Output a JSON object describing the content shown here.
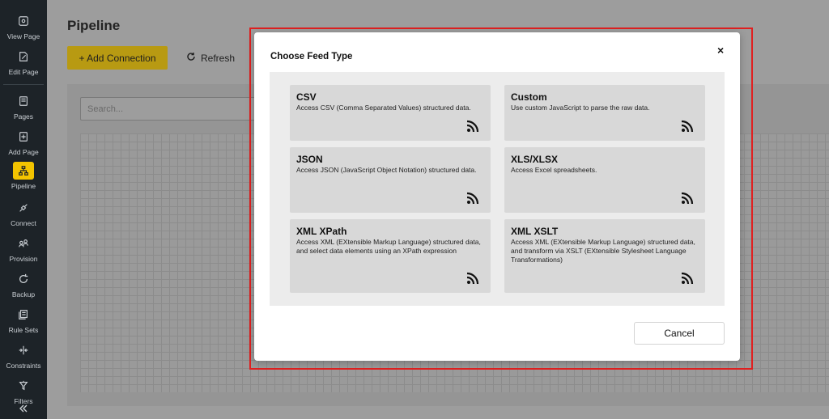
{
  "sidebar": {
    "items": [
      {
        "label": "View Page",
        "icon": "eye-icon"
      },
      {
        "label": "Edit Page",
        "icon": "edit-page-icon"
      },
      {
        "label": "Pages",
        "icon": "pages-icon"
      },
      {
        "label": "Add Page",
        "icon": "add-page-icon"
      },
      {
        "label": "Pipeline",
        "icon": "pipeline-icon",
        "active": true
      },
      {
        "label": "Connect",
        "icon": "connect-icon"
      },
      {
        "label": "Provision",
        "icon": "provision-icon"
      },
      {
        "label": "Backup",
        "icon": "backup-icon"
      },
      {
        "label": "Rule Sets",
        "icon": "rule-sets-icon"
      },
      {
        "label": "Constraints",
        "icon": "constraints-icon"
      },
      {
        "label": "Filters",
        "icon": "filters-icon"
      }
    ],
    "collapse_icon": "double-chevron-left-icon",
    "active_color": "#f3c400"
  },
  "main": {
    "title": "Pipeline",
    "add_connection_label": "+ Add Connection",
    "refresh_label": "Refresh",
    "search_placeholder": "Search..."
  },
  "modal": {
    "title": "Choose Feed Type",
    "close_label": "×",
    "cancel_label": "Cancel",
    "feed_types": [
      {
        "name": "CSV",
        "description": "Access CSV (Comma Separated Values) structured data."
      },
      {
        "name": "Custom",
        "description": "Use custom JavaScript to parse the raw data."
      },
      {
        "name": "JSON",
        "description": "Access JSON (JavaScript Object Notation) structured data."
      },
      {
        "name": "XLS/XLSX",
        "description": "Access Excel spreadsheets."
      },
      {
        "name": "XML XPath",
        "description": "Access XML (EXtensible Markup Language) structured data, and select data elements using an XPath expression"
      },
      {
        "name": "XML XSLT",
        "description": "Access XML (EXtensible Markup Language) structured data, and transform via XSLT (EXtensible Stylesheet Language Transformations)"
      }
    ],
    "highlight_color": "#e02020"
  }
}
